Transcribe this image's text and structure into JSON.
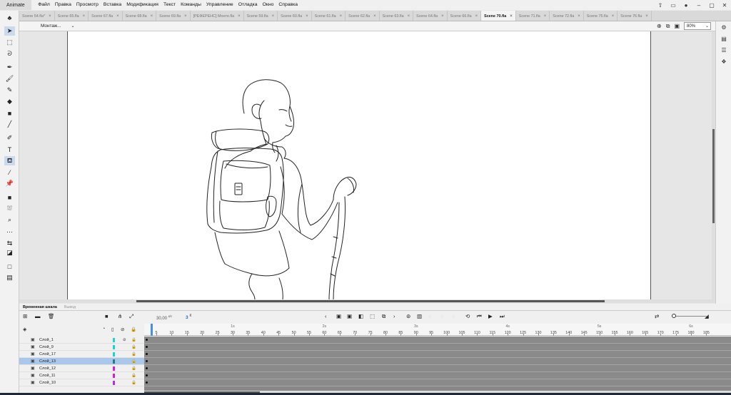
{
  "menubar": {
    "app_name": "Animate",
    "items": [
      "Файл",
      "Правка",
      "Просмотр",
      "Вставка",
      "Модификация",
      "Текст",
      "Команды",
      "Управление",
      "Отладка",
      "Окно",
      "Справка"
    ]
  },
  "doc_tabs": [
    {
      "label": "Scene 54.fla*",
      "active": false
    },
    {
      "label": "Scene 65.fla",
      "active": false
    },
    {
      "label": "Scene 67.fla",
      "active": false
    },
    {
      "label": "Scene 68.fla",
      "active": false
    },
    {
      "label": "Scene 69.fla",
      "active": false
    },
    {
      "label": "[РЕФЕРЕНС] Монте.fla",
      "active": false
    },
    {
      "label": "Scene 59.fla",
      "active": false
    },
    {
      "label": "Scene 60.fla",
      "active": false
    },
    {
      "label": "Scene 61.fla",
      "active": false
    },
    {
      "label": "Scene 62.fla",
      "active": false
    },
    {
      "label": "Scene 63.fla",
      "active": false
    },
    {
      "label": "Scene 64.fla",
      "active": false
    },
    {
      "label": "Scene 66.fla",
      "active": false
    },
    {
      "label": "Scene 70.fla",
      "active": true
    },
    {
      "label": "Scene 71.fla",
      "active": false
    },
    {
      "label": "Scene 72.fla",
      "active": false
    },
    {
      "label": "Scene 75.fla",
      "active": false
    },
    {
      "label": "Scene 76.fla",
      "active": false
    }
  ],
  "editbar": {
    "scene_label": "Монтаж...",
    "zoom": "80%"
  },
  "timeline": {
    "tabs": [
      {
        "label": "Временная шкала",
        "active": true
      },
      {
        "label": "Вывод",
        "active": false
      }
    ],
    "fps": "30,00",
    "fps_unit": "к/с",
    "current_frame": "3",
    "frame_suffix": "К",
    "ruler_numbers": [
      "5",
      "10",
      "15",
      "20",
      "25",
      "30",
      "35",
      "40",
      "45",
      "50",
      "55",
      "60",
      "65",
      "70",
      "75",
      "80",
      "85",
      "90",
      "95",
      "100",
      "105",
      "110",
      "115",
      "120",
      "125",
      "130",
      "135",
      "140",
      "145",
      "150",
      "155",
      "160",
      "165",
      "170",
      "175",
      "180",
      "185"
    ],
    "second_marks": [
      "1s",
      "2s",
      "3s",
      "4s",
      "5s",
      "6s"
    ],
    "layers": [
      {
        "name": "Слой_1",
        "color": "#19d4d4",
        "selected": false
      },
      {
        "name": "Слой_9",
        "color": "#19d4d4",
        "selected": false
      },
      {
        "name": "Слой_17",
        "color": "#19d4d4",
        "selected": false
      },
      {
        "name": "Слой_13",
        "color": "#1e7f86",
        "selected": true
      },
      {
        "name": "Слой_12",
        "color": "#d11fd1",
        "selected": false
      },
      {
        "name": "Слой_11",
        "color": "#d11fd1",
        "selected": false
      },
      {
        "name": "Слой_10",
        "color": "#b531e0",
        "selected": false
      }
    ]
  },
  "colors": {
    "accent": "#4a90e2",
    "selection": "#a9c7ea",
    "frames": "#8a8a8a"
  }
}
